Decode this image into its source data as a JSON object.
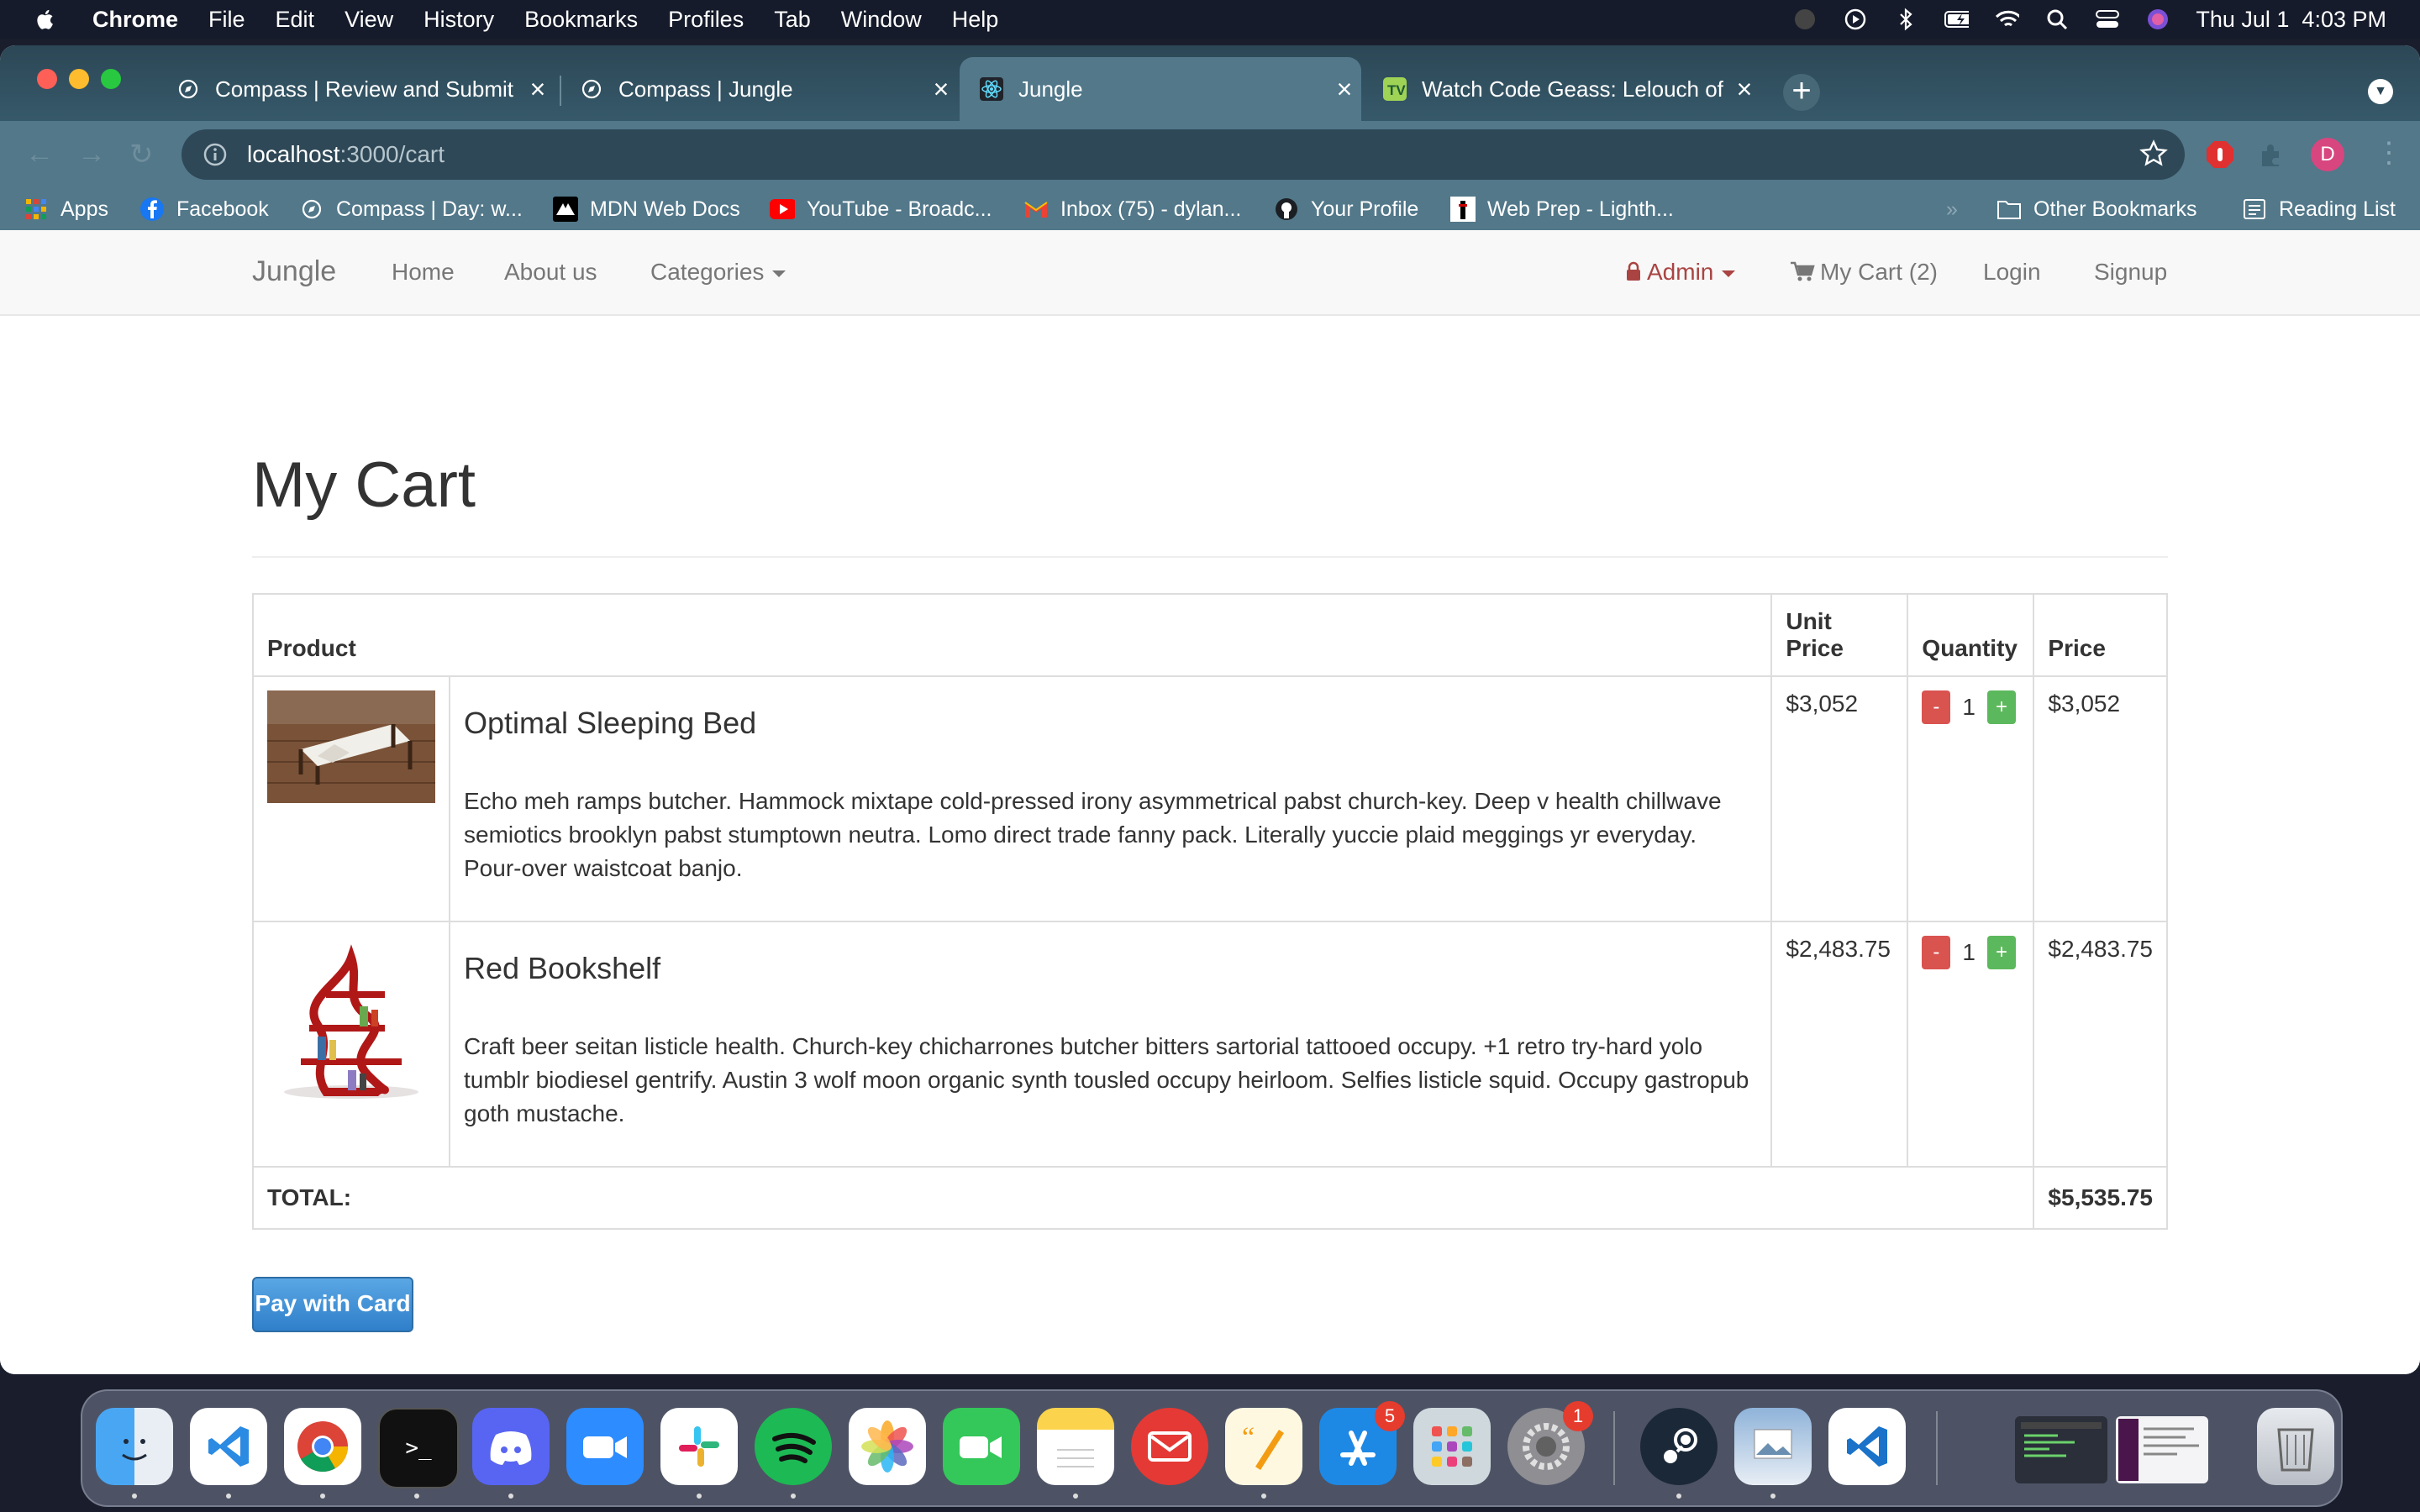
{
  "menubar": {
    "app": "Chrome",
    "items": [
      "File",
      "Edit",
      "View",
      "History",
      "Bookmarks",
      "Profiles",
      "Tab",
      "Window",
      "Help"
    ],
    "clock": "Thu Jul 1  4:03 PM"
  },
  "tabs": [
    {
      "title": "Compass | Review and Submit",
      "icon": "compass-icon"
    },
    {
      "title": "Compass | Jungle",
      "icon": "compass-icon"
    },
    {
      "title": "Jungle",
      "icon": "react-icon",
      "active": true
    },
    {
      "title": "Watch Code Geass: Lelouch of",
      "icon": "tv-icon"
    }
  ],
  "address": {
    "host": "localhost",
    "path": ":3000/cart"
  },
  "profile_initial": "D",
  "bookmarks": {
    "items": [
      {
        "label": "Apps",
        "icon": "apps-grid-icon"
      },
      {
        "label": "Facebook",
        "icon": "facebook-icon"
      },
      {
        "label": "Compass | Day: w...",
        "icon": "compass-icon"
      },
      {
        "label": "MDN Web Docs",
        "icon": "mdn-icon"
      },
      {
        "label": "YouTube - Broadc...",
        "icon": "youtube-icon"
      },
      {
        "label": "Inbox (75) - dylan...",
        "icon": "gmail-icon"
      },
      {
        "label": "Your Profile",
        "icon": "github-icon"
      },
      {
        "label": "Web Prep - Lighth...",
        "icon": "lighthouse-icon"
      }
    ],
    "more": "»",
    "other": "Other Bookmarks",
    "reading": "Reading List"
  },
  "navbar": {
    "brand": "Jungle",
    "links": [
      "Home",
      "About us",
      "Categories"
    ],
    "admin": "Admin",
    "cart": "My Cart (2)",
    "login": "Login",
    "signup": "Signup"
  },
  "page": {
    "title": "My Cart"
  },
  "table": {
    "headers": {
      "product": "Product",
      "unit_price_1": "Unit",
      "unit_price_2": "Price",
      "quantity": "Quantity",
      "price": "Price"
    },
    "rows": [
      {
        "name": "Optimal Sleeping Bed",
        "description": "Echo meh ramps butcher. Hammock mixtape cold-pressed irony asymmetrical pabst church-key. Deep v health chillwave semiotics brooklyn pabst stumptown neutra. Lomo direct trade fanny pack. Literally yuccie plaid meggings yr everyday. Pour-over waistcoat banjo.",
        "unit_price": "$3,052",
        "quantity": "1",
        "price": "$3,052"
      },
      {
        "name": "Red Bookshelf",
        "description": "Craft beer seitan listicle health. Church-key chicharrones butcher bitters sartorial tattooed occupy. +1 retro try-hard yolo tumblr biodiesel gentrify. Austin 3 wolf moon organic synth tousled occupy heirloom. Selfies listicle squid. Occupy gastropub goth mustache.",
        "unit_price": "$2,483.75",
        "quantity": "1",
        "price": "$2,483.75"
      }
    ],
    "minus": "-",
    "plus": "+",
    "total_label": "TOTAL:",
    "total_value": "$5,535.75"
  },
  "pay_button": "Pay with Card",
  "dock": {
    "badges": {
      "app_store": "5",
      "system_prefs": "1"
    }
  },
  "colors": {
    "navbar_bg": "#f8f8f8",
    "admin": "#a94442",
    "pay_button": "#337ab7",
    "minus": "#d9534f",
    "plus": "#5cb85c",
    "tab_active": "#52788a"
  }
}
